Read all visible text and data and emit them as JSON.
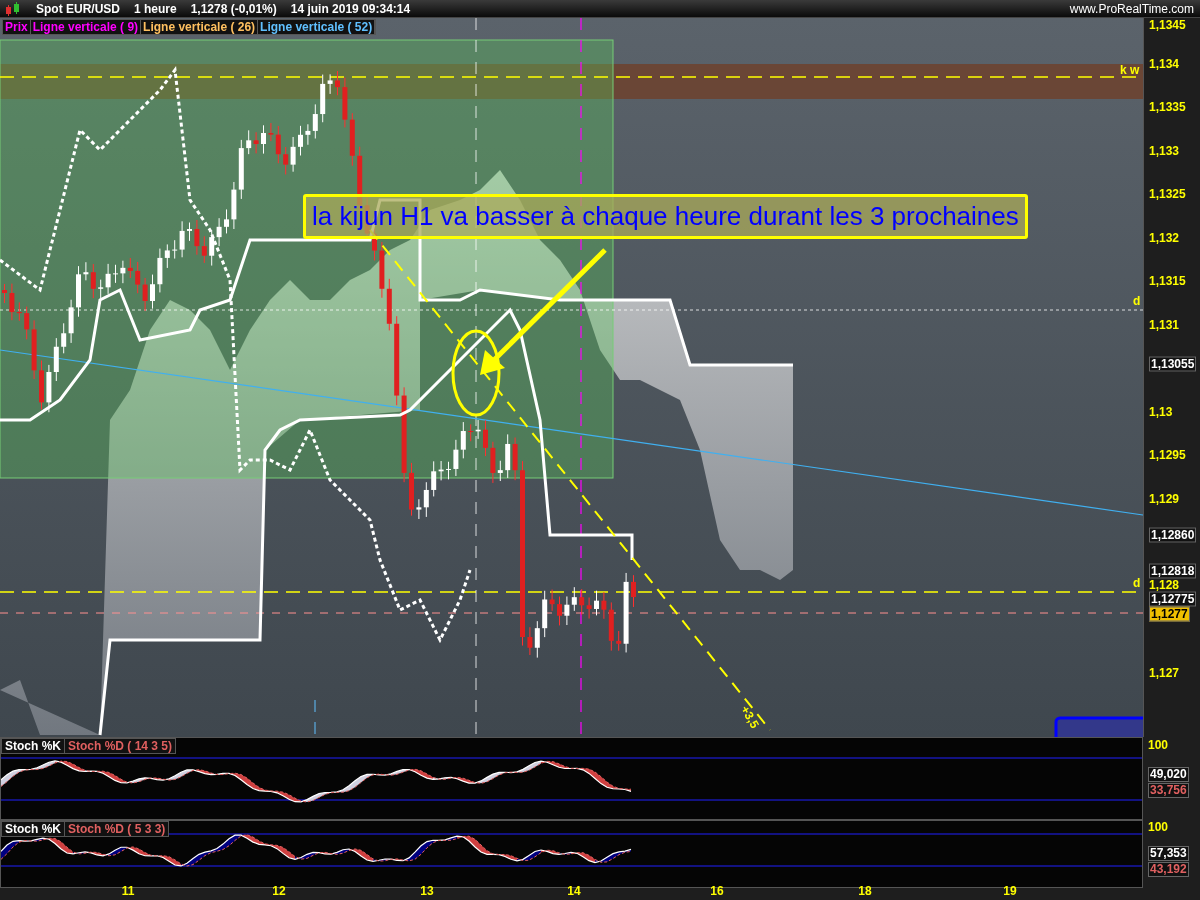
{
  "header": {
    "symbol": "Spot EUR/USD",
    "timeframe": "1 heure",
    "price": "1,1278 (-0,01%)",
    "datetime": "14 juin 2019 09:34:14",
    "website": "www.ProRealTime.com"
  },
  "legend": [
    "Prix",
    "Ligne verticale ( 9)",
    "Ligne verticale ( 26)",
    "Ligne verticale ( 52)"
  ],
  "annotation": {
    "text": "la kijun H1 va basser à chaque heure durant les 3 prochaines"
  },
  "chart_labels": [
    {
      "kind": "level",
      "text": "k w"
    },
    {
      "kind": "level",
      "text": "d"
    },
    {
      "kind": "level",
      "text": "d"
    },
    {
      "kind": "projection",
      "text": "+3,5"
    }
  ],
  "price_axis": [
    {
      "kind": "tick",
      "label": "1,1345"
    },
    {
      "kind": "tick",
      "label": "1,134"
    },
    {
      "kind": "tick",
      "label": "1,1335"
    },
    {
      "kind": "tick",
      "label": "1,133"
    },
    {
      "kind": "tick",
      "label": "1,1325"
    },
    {
      "kind": "tick",
      "label": "1,132"
    },
    {
      "kind": "tick",
      "label": "1,1315"
    },
    {
      "kind": "tick",
      "label": "1,131"
    },
    {
      "kind": "tag",
      "label": "1,13055"
    },
    {
      "kind": "tick",
      "label": "1,13"
    },
    {
      "kind": "tick",
      "label": "1,1295"
    },
    {
      "kind": "tick",
      "label": "1,129"
    },
    {
      "kind": "tag",
      "label": "1,12860"
    },
    {
      "kind": "tag",
      "label": "1,12818"
    },
    {
      "kind": "tick",
      "label": "1,128"
    },
    {
      "kind": "tag",
      "label": "1,12775"
    },
    {
      "kind": "current",
      "label": "1,1277"
    },
    {
      "kind": "tick",
      "label": "1,127"
    }
  ],
  "stoch_panels": [
    {
      "k_label": "Stoch %K",
      "d_label": "Stoch %D ( 14 3 5)",
      "top_tick": "100",
      "k_value": "49,020",
      "d_value": "33,756"
    },
    {
      "k_label": "Stoch %K",
      "d_label": "Stoch %D ( 5 3 3)",
      "top_tick": "100",
      "k_value": "57,353",
      "d_value": "43,192"
    }
  ],
  "x_axis": [
    "11",
    "12",
    "13",
    "14",
    "16",
    "18",
    "19"
  ]
}
